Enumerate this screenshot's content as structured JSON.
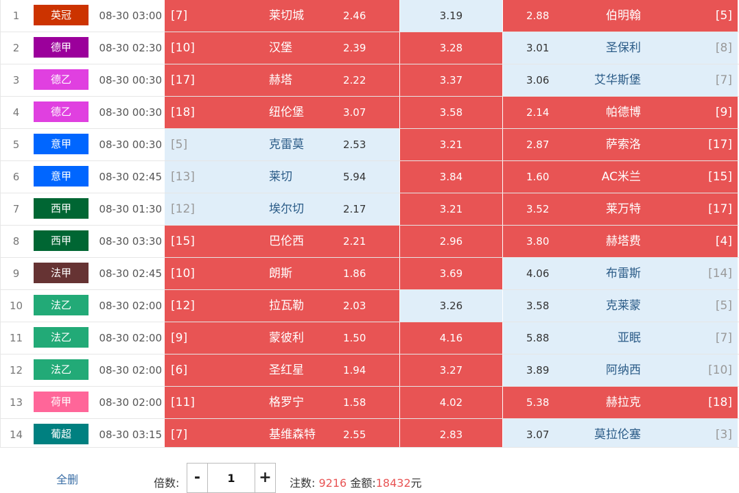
{
  "colors": {
    "selected_bg": "#e85454",
    "unselected_bg": "#e0eef9",
    "footer_number": "#e85454",
    "link": "#3a6ea5"
  },
  "matches": [
    {
      "no": "1",
      "league": "英冠",
      "league_color": "#cc3300",
      "time": "08-30 03:00",
      "home_rank": "[7]",
      "home": "莱切城",
      "home_odd": "2.46",
      "home_selected": true,
      "draw_odd": "3.19",
      "draw_selected": false,
      "away_odd": "2.88",
      "away": "伯明翰",
      "away_rank": "[5]",
      "away_selected": true
    },
    {
      "no": "2",
      "league": "德甲",
      "league_color": "#9b009b",
      "time": "08-30 02:30",
      "home_rank": "[10]",
      "home": "汉堡",
      "home_odd": "2.39",
      "home_selected": true,
      "draw_odd": "3.28",
      "draw_selected": true,
      "away_odd": "3.01",
      "away": "圣保利",
      "away_rank": "[8]",
      "away_selected": false
    },
    {
      "no": "3",
      "league": "德乙",
      "league_color": "#e040e0",
      "time": "08-30 00:30",
      "home_rank": "[17]",
      "home": "赫塔",
      "home_odd": "2.22",
      "home_selected": true,
      "draw_odd": "3.37",
      "draw_selected": true,
      "away_odd": "3.06",
      "away": "艾华斯堡",
      "away_rank": "[7]",
      "away_selected": false
    },
    {
      "no": "4",
      "league": "德乙",
      "league_color": "#e040e0",
      "time": "08-30 00:30",
      "home_rank": "[18]",
      "home": "纽伦堡",
      "home_odd": "3.07",
      "home_selected": true,
      "draw_odd": "3.58",
      "draw_selected": true,
      "away_odd": "2.14",
      "away": "帕德博",
      "away_rank": "[9]",
      "away_selected": true
    },
    {
      "no": "5",
      "league": "意甲",
      "league_color": "#0066ff",
      "time": "08-30 00:30",
      "home_rank": "[5]",
      "home": "克雷莫",
      "home_odd": "2.53",
      "home_selected": false,
      "draw_odd": "3.21",
      "draw_selected": true,
      "away_odd": "2.87",
      "away": "萨索洛",
      "away_rank": "[17]",
      "away_selected": true
    },
    {
      "no": "6",
      "league": "意甲",
      "league_color": "#0066ff",
      "time": "08-30 02:45",
      "home_rank": "[13]",
      "home": "莱切",
      "home_odd": "5.94",
      "home_selected": false,
      "draw_odd": "3.84",
      "draw_selected": true,
      "away_odd": "1.60",
      "away": "AC米兰",
      "away_rank": "[15]",
      "away_selected": true
    },
    {
      "no": "7",
      "league": "西甲",
      "league_color": "#006633",
      "time": "08-30 01:30",
      "home_rank": "[12]",
      "home": "埃尔切",
      "home_odd": "2.17",
      "home_selected": false,
      "draw_odd": "3.21",
      "draw_selected": true,
      "away_odd": "3.52",
      "away": "莱万特",
      "away_rank": "[17]",
      "away_selected": true
    },
    {
      "no": "8",
      "league": "西甲",
      "league_color": "#006633",
      "time": "08-30 03:30",
      "home_rank": "[15]",
      "home": "巴伦西",
      "home_odd": "2.21",
      "home_selected": true,
      "draw_odd": "2.96",
      "draw_selected": true,
      "away_odd": "3.80",
      "away": "赫塔费",
      "away_rank": "[4]",
      "away_selected": true
    },
    {
      "no": "9",
      "league": "法甲",
      "league_color": "#663333",
      "time": "08-30 02:45",
      "home_rank": "[10]",
      "home": "朗斯",
      "home_odd": "1.86",
      "home_selected": true,
      "draw_odd": "3.69",
      "draw_selected": true,
      "away_odd": "4.06",
      "away": "布雷斯",
      "away_rank": "[14]",
      "away_selected": false
    },
    {
      "no": "10",
      "league": "法乙",
      "league_color": "#22aa77",
      "time": "08-30 02:00",
      "home_rank": "[12]",
      "home": "拉瓦勒",
      "home_odd": "2.03",
      "home_selected": true,
      "draw_odd": "3.26",
      "draw_selected": false,
      "away_odd": "3.58",
      "away": "克莱蒙",
      "away_rank": "[5]",
      "away_selected": false
    },
    {
      "no": "11",
      "league": "法乙",
      "league_color": "#22aa77",
      "time": "08-30 02:00",
      "home_rank": "[9]",
      "home": "蒙彼利",
      "home_odd": "1.50",
      "home_selected": true,
      "draw_odd": "4.16",
      "draw_selected": true,
      "away_odd": "5.88",
      "away": "亚眠",
      "away_rank": "[7]",
      "away_selected": false
    },
    {
      "no": "12",
      "league": "法乙",
      "league_color": "#22aa77",
      "time": "08-30 02:00",
      "home_rank": "[6]",
      "home": "圣红星",
      "home_odd": "1.94",
      "home_selected": true,
      "draw_odd": "3.27",
      "draw_selected": true,
      "away_odd": "3.89",
      "away": "阿纳西",
      "away_rank": "[10]",
      "away_selected": false
    },
    {
      "no": "13",
      "league": "荷甲",
      "league_color": "#ff6699",
      "time": "08-30 02:00",
      "home_rank": "[11]",
      "home": "格罗宁",
      "home_odd": "1.58",
      "home_selected": true,
      "draw_odd": "4.02",
      "draw_selected": true,
      "away_odd": "5.38",
      "away": "赫拉克",
      "away_rank": "[18]",
      "away_selected": true
    },
    {
      "no": "14",
      "league": "葡超",
      "league_color": "#008080",
      "time": "08-30 03:15",
      "home_rank": "[7]",
      "home": "基维森特",
      "home_odd": "2.55",
      "home_selected": true,
      "draw_odd": "2.83",
      "draw_selected": true,
      "away_odd": "3.07",
      "away": "莫拉伦塞",
      "away_rank": "[3]",
      "away_selected": false
    }
  ],
  "footer": {
    "clear_all": "全删",
    "multiplier_label": "倍数:",
    "minus": "-",
    "multiplier_value": "1",
    "plus": "+",
    "bets_label": "注数:",
    "bets_count": "9216",
    "amount_label": "金额:",
    "amount_value": "18432",
    "currency": "元"
  }
}
